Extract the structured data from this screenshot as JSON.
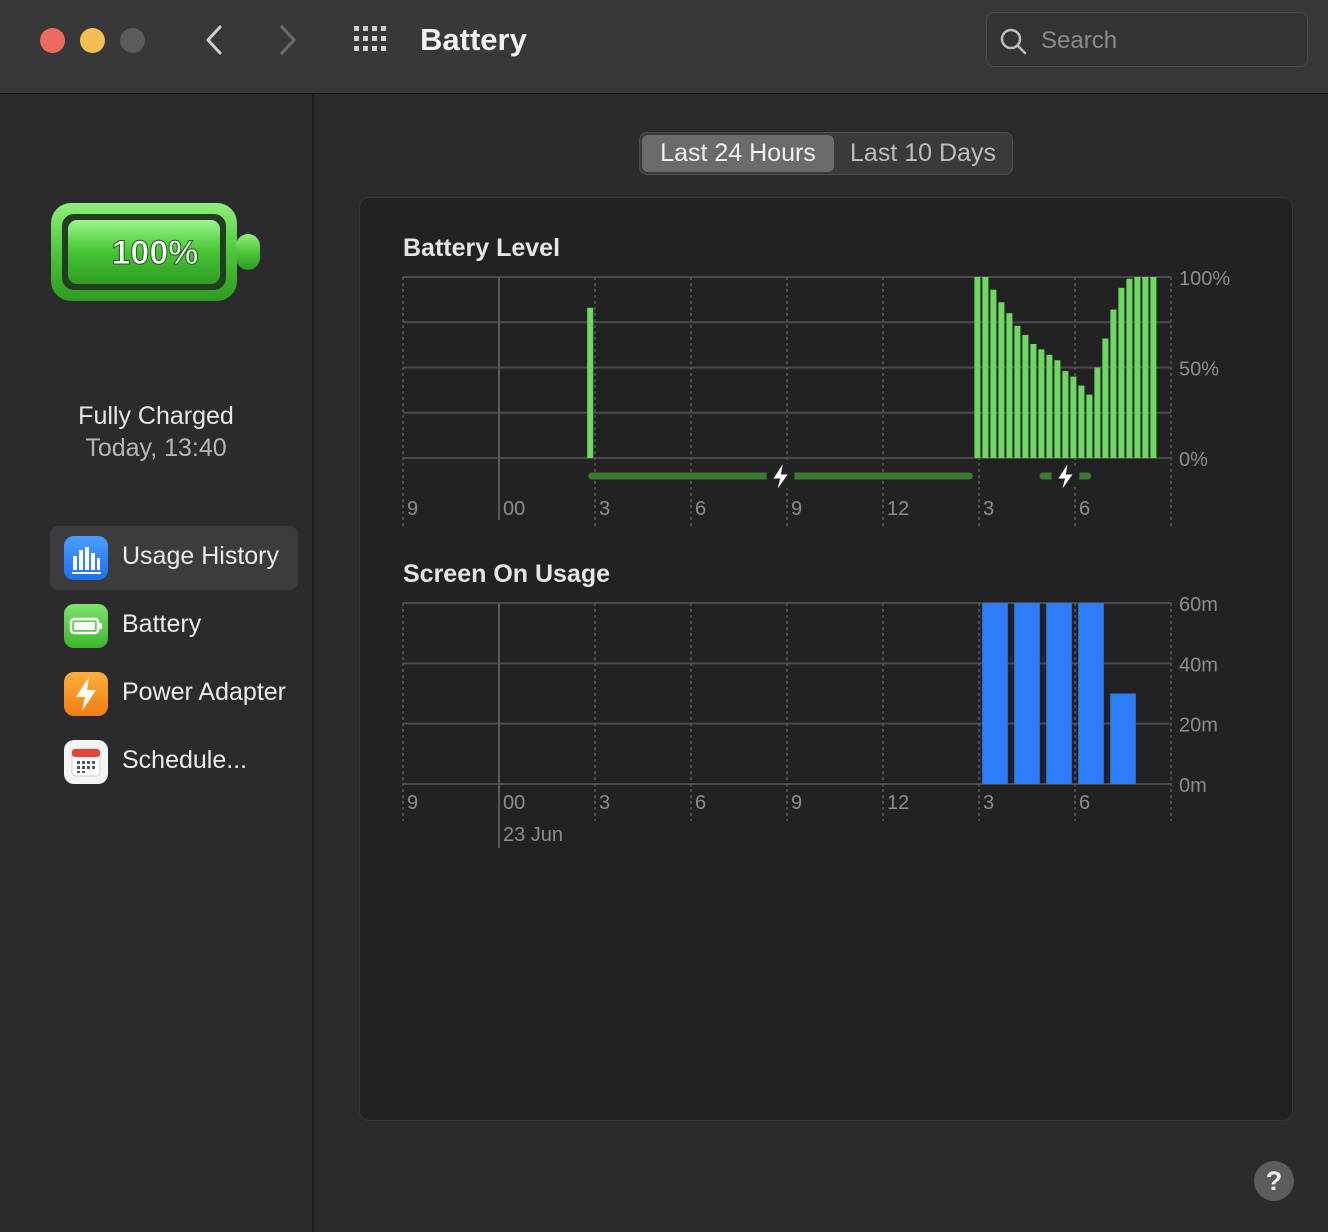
{
  "window": {
    "title": "Battery"
  },
  "search": {
    "placeholder": "Search"
  },
  "battery_status": {
    "percent_label": "100%",
    "level": 1.0,
    "state": "Fully Charged",
    "time": "Today, 13:40"
  },
  "sidebar": {
    "items": [
      {
        "label": "Usage History",
        "icon": "bar-chart-icon",
        "active": true
      },
      {
        "label": "Battery",
        "icon": "battery-icon",
        "active": false
      },
      {
        "label": "Power Adapter",
        "icon": "bolt-icon",
        "active": false
      },
      {
        "label": "Schedule...",
        "icon": "calendar-icon",
        "active": false
      }
    ]
  },
  "range_tabs": [
    {
      "label": "Last 24 Hours",
      "selected": true
    },
    {
      "label": "Last 10 Days",
      "selected": false
    }
  ],
  "colors": {
    "battery_green": "#6fd860",
    "charge_bar": "#3d7a32",
    "usage_blue": "#2f7df6"
  },
  "chart_data": [
    {
      "type": "bar",
      "title": "Battery Level",
      "x_unit": "hours",
      "x_range": [
        9,
        33
      ],
      "x_tick_labels": [
        "9",
        "00",
        "3",
        "6",
        "9",
        "12",
        "3",
        "6"
      ],
      "y_tick_labels": [
        "100%",
        "50%",
        "0%"
      ],
      "ylim": [
        0,
        100
      ],
      "grid": true,
      "series": [
        {
          "x": [
            14.85,
            26.95,
            27.2,
            27.45,
            27.7,
            27.95,
            28.2,
            28.45,
            28.7,
            28.95,
            29.2,
            29.45,
            29.7,
            29.95,
            30.2,
            30.45,
            30.7,
            30.95,
            31.2,
            31.45,
            31.7,
            31.95,
            32.2,
            32.45
          ],
          "values": [
            83,
            100,
            100,
            93,
            86,
            80,
            73,
            68,
            63,
            60,
            57,
            54,
            48,
            45,
            40,
            35,
            50,
            66,
            82,
            94,
            99,
            100,
            100,
            100
          ]
        }
      ],
      "charging_periods": [
        [
          14.9,
          26.7
        ],
        [
          29.0,
          30.4
        ]
      ]
    },
    {
      "type": "bar",
      "title": "Screen On Usage",
      "x_unit": "hours",
      "x_range": [
        9,
        33
      ],
      "x_tick_labels": [
        "9",
        "00",
        "3",
        "6",
        "9",
        "12",
        "3",
        "6"
      ],
      "date_label": "23 Jun",
      "y_tick_labels": [
        "60m",
        "40m",
        "20m",
        "0m"
      ],
      "ylim": [
        0,
        60
      ],
      "grid": true,
      "series": [
        {
          "x": [
            27.5,
            28.5,
            29.5,
            30.5,
            31.5
          ],
          "values": [
            60,
            60,
            60,
            60,
            30
          ]
        }
      ]
    }
  ]
}
